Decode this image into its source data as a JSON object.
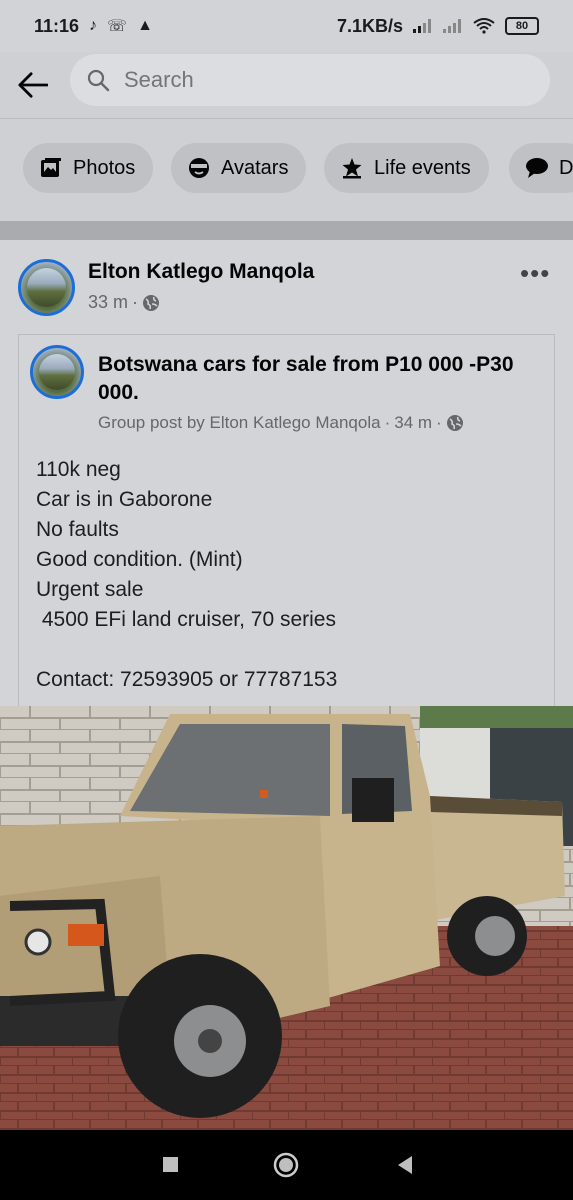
{
  "status": {
    "time": "11:16",
    "net_speed": "7.1KB/s",
    "battery": "80"
  },
  "search": {
    "placeholder": "Search"
  },
  "chips": [
    {
      "label": "Photos",
      "icon": "photo-icon"
    },
    {
      "label": "Avatars",
      "icon": "avatar-icon"
    },
    {
      "label": "Life events",
      "icon": "life-events-icon"
    },
    {
      "label": "D",
      "icon": "speech-bubble-icon"
    }
  ],
  "post": {
    "author": "Elton Katlego Manqola",
    "time": "33 m",
    "privacy_icon": "globe-icon",
    "shared": {
      "group_name": "Botswana  cars for sale from P10 000 -P30 000.",
      "byline": "Group post by Elton Katlego Manqola",
      "time": "34 m",
      "lines": [
        "110k neg",
        "Car is in Gaborone",
        "No faults",
        "Good condition. (Mint)",
        "Urgent sale",
        " 4500 EFi land cruiser, 70 series",
        "",
        "Contact: 72593905 or 77787153"
      ]
    },
    "photo_alt": "Beige Toyota Land Cruiser pickup"
  },
  "colors": {
    "accent": "#1c6ed6",
    "background": "#ced0d4"
  }
}
